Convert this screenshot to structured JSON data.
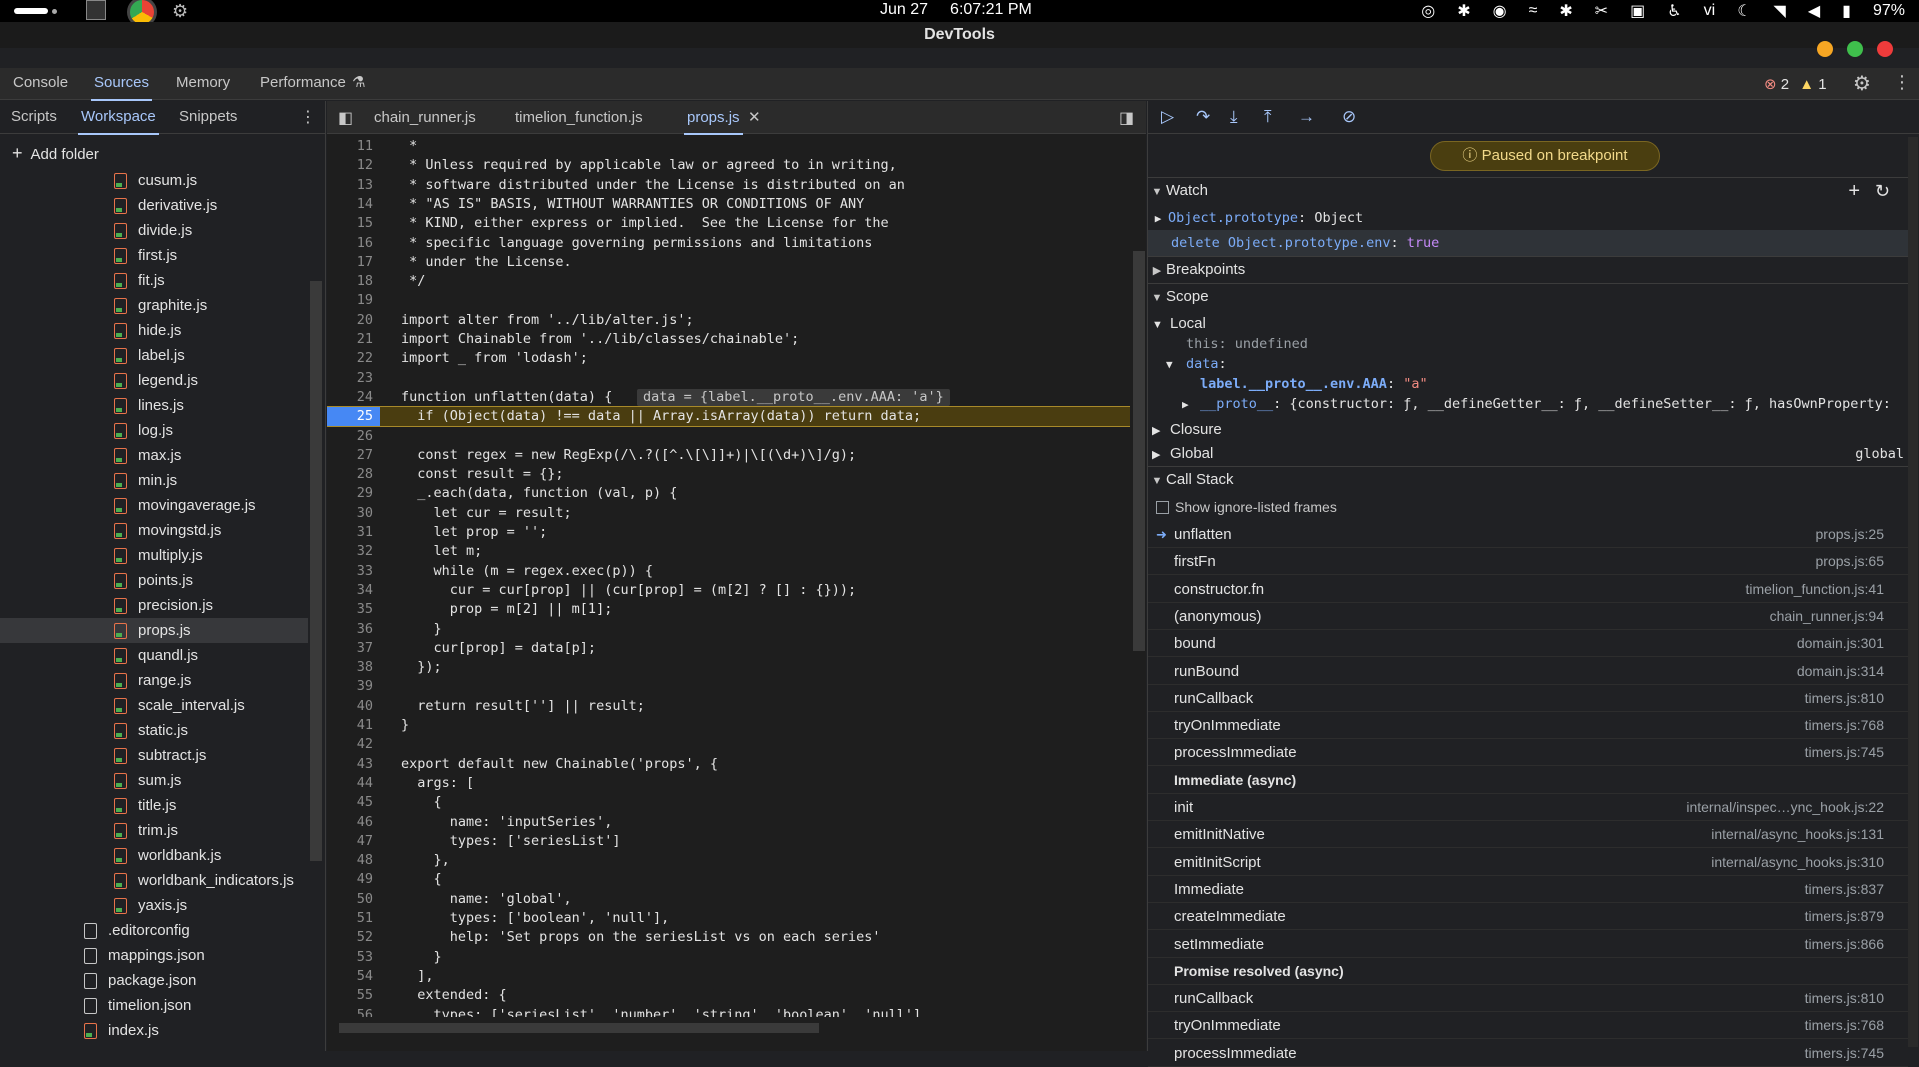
{
  "system": {
    "date": "Jun 27",
    "time": "6:07:21 PM",
    "lang": "vi",
    "battery": "97%"
  },
  "window": {
    "title": "DevTools"
  },
  "main_tabs": [
    "Console",
    "Sources",
    "Memory",
    "Performance"
  ],
  "issues": {
    "errors": "2",
    "warnings": "1"
  },
  "nav_tabs": [
    "Scripts",
    "Workspace",
    "Snippets"
  ],
  "add_folder": "Add folder",
  "files": [
    "cusum.js",
    "derivative.js",
    "divide.js",
    "first.js",
    "fit.js",
    "graphite.js",
    "hide.js",
    "label.js",
    "legend.js",
    "lines.js",
    "log.js",
    "max.js",
    "min.js",
    "movingaverage.js",
    "movingstd.js",
    "multiply.js",
    "points.js",
    "precision.js",
    "props.js",
    "quandl.js",
    "range.js",
    "scale_interval.js",
    "static.js",
    "subtract.js",
    "sum.js",
    "title.js",
    "trim.js",
    "worldbank.js",
    "worldbank_indicators.js",
    "yaxis.js"
  ],
  "root_files": [
    ".editorconfig",
    "mappings.json",
    "package.json",
    "timelion.json",
    "index.js"
  ],
  "editor_tabs": [
    "chain_runner.js",
    "timelion_function.js",
    "props.js"
  ],
  "code": [
    {
      "n": "11",
      "t": " *"
    },
    {
      "n": "12",
      "t": " * Unless required by applicable law or agreed to in writing,"
    },
    {
      "n": "13",
      "t": " * software distributed under the License is distributed on an"
    },
    {
      "n": "14",
      "t": " * \"AS IS\" BASIS, WITHOUT WARRANTIES OR CONDITIONS OF ANY"
    },
    {
      "n": "15",
      "t": " * KIND, either express or implied.  See the License for the"
    },
    {
      "n": "16",
      "t": " * specific language governing permissions and limitations"
    },
    {
      "n": "17",
      "t": " * under the License."
    },
    {
      "n": "18",
      "t": " */"
    },
    {
      "n": "19",
      "t": ""
    },
    {
      "n": "20",
      "t": "import alter from '../lib/alter.js';"
    },
    {
      "n": "21",
      "t": "import Chainable from '../lib/classes/chainable';"
    },
    {
      "n": "22",
      "t": "import _ from 'lodash';"
    },
    {
      "n": "23",
      "t": ""
    },
    {
      "n": "24",
      "t": "function unflatten(data) {"
    },
    {
      "n": "25",
      "t": "  if (Object(data) !== data || Array.isArray(data)) return data;"
    },
    {
      "n": "26",
      "t": ""
    },
    {
      "n": "27",
      "t": "  const regex = new RegExp(/\\.?([^.\\[\\]]+)|\\[(\\d+)\\]/g);"
    },
    {
      "n": "28",
      "t": "  const result = {};"
    },
    {
      "n": "29",
      "t": "  _.each(data, function (val, p) {"
    },
    {
      "n": "30",
      "t": "    let cur = result;"
    },
    {
      "n": "31",
      "t": "    let prop = '';"
    },
    {
      "n": "32",
      "t": "    let m;"
    },
    {
      "n": "33",
      "t": "    while (m = regex.exec(p)) {"
    },
    {
      "n": "34",
      "t": "      cur = cur[prop] || (cur[prop] = (m[2] ? [] : {}));"
    },
    {
      "n": "35",
      "t": "      prop = m[2] || m[1];"
    },
    {
      "n": "36",
      "t": "    }"
    },
    {
      "n": "37",
      "t": "    cur[prop] = data[p];"
    },
    {
      "n": "38",
      "t": "  });"
    },
    {
      "n": "39",
      "t": ""
    },
    {
      "n": "40",
      "t": "  return result[''] || result;"
    },
    {
      "n": "41",
      "t": "}"
    },
    {
      "n": "42",
      "t": ""
    },
    {
      "n": "43",
      "t": "export default new Chainable('props', {"
    },
    {
      "n": "44",
      "t": "  args: ["
    },
    {
      "n": "45",
      "t": "    {"
    },
    {
      "n": "46",
      "t": "      name: 'inputSeries',"
    },
    {
      "n": "47",
      "t": "      types: ['seriesList']"
    },
    {
      "n": "48",
      "t": "    },"
    },
    {
      "n": "49",
      "t": "    {"
    },
    {
      "n": "50",
      "t": "      name: 'global',"
    },
    {
      "n": "51",
      "t": "      types: ['boolean', 'null'],"
    },
    {
      "n": "52",
      "t": "      help: 'Set props on the seriesList vs on each series'"
    },
    {
      "n": "53",
      "t": "    }"
    },
    {
      "n": "54",
      "t": "  ],"
    },
    {
      "n": "55",
      "t": "  extended: {"
    },
    {
      "n": "56",
      "t": "    types: ['seriesList', 'number', 'string', 'boolean', 'null'],"
    }
  ],
  "inline_value": "data = {label.__proto__.env.AAA: 'a'}",
  "paused": "Paused on breakpoint",
  "watch": {
    "title": "Watch",
    "e1_key": "Object.prototype",
    "e1_val": "Object",
    "e2_expr": "delete Object.prototype.env",
    "e2_val": "true"
  },
  "breakpoints": "Breakpoints",
  "scope": {
    "title": "Scope",
    "local": "Local",
    "this_key": "this",
    "this_val": "undefined",
    "data_key": "data",
    "label_key": "label.__proto__.env.AAA",
    "label_val": "\"a\"",
    "proto_key": "__proto__",
    "proto_val": "{constructor: ƒ, __defineGetter__: ƒ, __defineSetter__: ƒ, hasOwnProperty:",
    "closure": "Closure",
    "global": "Global",
    "global_val": "global"
  },
  "callstack": {
    "title": "Call Stack",
    "show_ignored": "Show ignore-listed frames",
    "frames": [
      {
        "fn": "unflatten",
        "loc": "props.js:25"
      },
      {
        "fn": "firstFn",
        "loc": "props.js:65"
      },
      {
        "fn": "constructor.fn",
        "loc": "timelion_function.js:41"
      },
      {
        "fn": "(anonymous)",
        "loc": "chain_runner.js:94"
      },
      {
        "fn": "bound",
        "loc": "domain.js:301"
      },
      {
        "fn": "runBound",
        "loc": "domain.js:314"
      },
      {
        "fn": "runCallback",
        "loc": "timers.js:810"
      },
      {
        "fn": "tryOnImmediate",
        "loc": "timers.js:768"
      },
      {
        "fn": "processImmediate",
        "loc": "timers.js:745"
      },
      {
        "fn": "Immediate (async)",
        "loc": "",
        "group": true
      },
      {
        "fn": "init",
        "loc": "internal/inspec…ync_hook.js:22"
      },
      {
        "fn": "emitInitNative",
        "loc": "internal/async_hooks.js:131"
      },
      {
        "fn": "emitInitScript",
        "loc": "internal/async_hooks.js:310"
      },
      {
        "fn": "Immediate",
        "loc": "timers.js:837"
      },
      {
        "fn": "createImmediate",
        "loc": "timers.js:879"
      },
      {
        "fn": "setImmediate",
        "loc": "timers.js:866"
      },
      {
        "fn": "Promise resolved (async)",
        "loc": "",
        "group": true
      },
      {
        "fn": "runCallback",
        "loc": "timers.js:810"
      },
      {
        "fn": "tryOnImmediate",
        "loc": "timers.js:768"
      },
      {
        "fn": "processImmediate",
        "loc": "timers.js:745"
      }
    ]
  }
}
